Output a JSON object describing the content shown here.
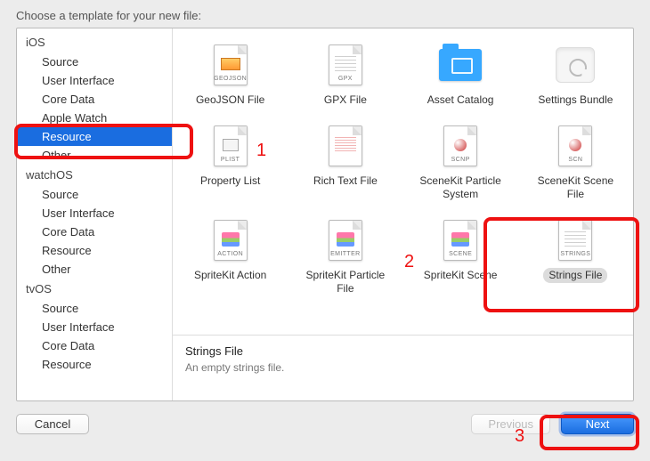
{
  "header": {
    "title": "Choose a template for your new file:"
  },
  "sidebar": {
    "platforms": [
      {
        "name": "iOS",
        "cats": [
          {
            "label": "Source"
          },
          {
            "label": "User Interface"
          },
          {
            "label": "Core Data"
          },
          {
            "label": "Apple Watch"
          },
          {
            "label": "Resource",
            "selected": true
          },
          {
            "label": "Other"
          }
        ]
      },
      {
        "name": "watchOS",
        "cats": [
          {
            "label": "Source"
          },
          {
            "label": "User Interface"
          },
          {
            "label": "Core Data"
          },
          {
            "label": "Resource"
          },
          {
            "label": "Other"
          }
        ]
      },
      {
        "name": "tvOS",
        "cats": [
          {
            "label": "Source"
          },
          {
            "label": "User Interface"
          },
          {
            "label": "Core Data"
          },
          {
            "label": "Resource"
          }
        ]
      }
    ]
  },
  "templates": {
    "rows": [
      [
        {
          "label": "GeoJSON File",
          "icon": "doc",
          "tag": "GEOJSON",
          "mid": "photo"
        },
        {
          "label": "GPX File",
          "icon": "doc",
          "tag": "GPX",
          "mid": "lines"
        },
        {
          "label": "Asset Catalog",
          "icon": "folder"
        },
        {
          "label": "Settings Bundle",
          "icon": "bundle"
        }
      ],
      [
        {
          "label": "Property List",
          "icon": "doc",
          "tag": "PLIST",
          "mid": "box"
        },
        {
          "label": "Rich Text File",
          "icon": "doc",
          "tag": "",
          "mid": "text"
        },
        {
          "label": "SceneKit Particle System",
          "icon": "doc",
          "tag": "SCNP",
          "mid": "ball"
        },
        {
          "label": "SceneKit Scene File",
          "icon": "doc",
          "tag": "SCN",
          "mid": "ball"
        }
      ],
      [
        {
          "label": "SpriteKit Action",
          "icon": "doc",
          "tag": "ACTION",
          "mid": "stack"
        },
        {
          "label": "SpriteKit Particle File",
          "icon": "doc",
          "tag": "EMITTER",
          "mid": "stack"
        },
        {
          "label": "SpriteKit Scene",
          "icon": "doc",
          "tag": "SCENE",
          "mid": "stack"
        },
        {
          "label": "Strings File",
          "icon": "doc",
          "tag": "STRINGS",
          "mid": "lines",
          "selected": true
        }
      ]
    ]
  },
  "description": {
    "title": "Strings File",
    "subtitle": "An empty strings file."
  },
  "footer": {
    "cancel": "Cancel",
    "previous": "Previous",
    "next": "Next"
  },
  "annotations": {
    "n1": "1",
    "n2": "2",
    "n3": "3"
  }
}
